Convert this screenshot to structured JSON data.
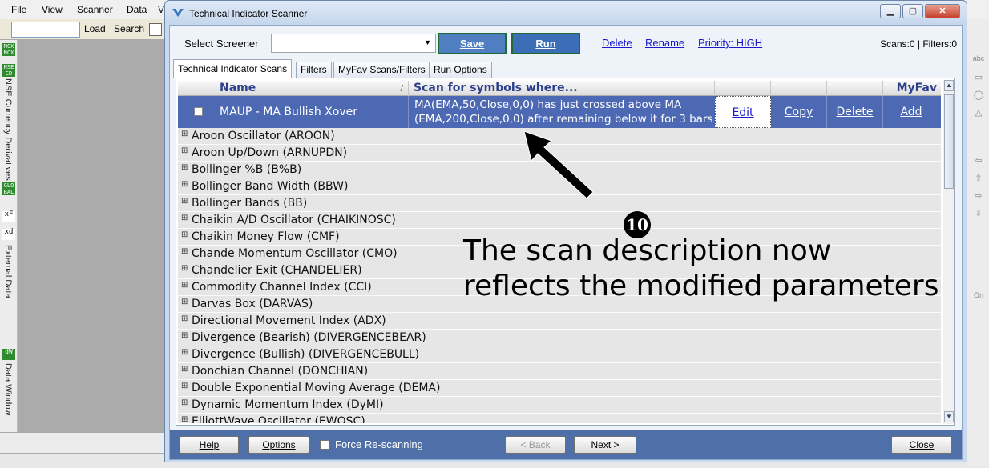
{
  "app_menu": {
    "items": [
      {
        "label": "File",
        "accel": "F",
        "rest": "ile"
      },
      {
        "label": "View",
        "accel": "V",
        "rest": "iew"
      },
      {
        "label": "Scanner",
        "accel": "S",
        "rest": "canner"
      },
      {
        "label": "Data",
        "accel": "D",
        "rest": "ata"
      },
      {
        "label": "V",
        "accel": "V",
        "rest": ""
      }
    ]
  },
  "bg_toolbar": {
    "load_label": "Load",
    "search_label": "Search"
  },
  "left_sidebar": {
    "badges": [
      "MCX NCX",
      "NSE CD",
      "GLO BAL"
    ],
    "labels": [
      "NSE Currency Derivatives",
      "External Data",
      "Data Window"
    ],
    "icon_f": "xF",
    "icon_d": "xd",
    "icon_dw": "dW"
  },
  "dialog": {
    "title": "Technical Indicator Scanner",
    "select_screener_label": "Select Screener",
    "screener_value": "",
    "save_label": "Save",
    "run_label": "Run",
    "delete_link": "Delete",
    "rename_link": "Rename",
    "priority_link": "Priority: HIGH",
    "scans_count": "Scans:0 | Filters:0",
    "tabs": [
      {
        "label": "Technical Indicator Scans",
        "active": true
      },
      {
        "label": "Filters",
        "active": false
      },
      {
        "label": "MyFav Scans/Filters",
        "active": false
      },
      {
        "label": "Run Options",
        "active": false
      }
    ],
    "grid": {
      "headers": {
        "name": "Name",
        "sort_marker": "/",
        "scan": "Scan for symbols where...",
        "myfav": "MyFav"
      },
      "selected_row": {
        "name": "MAUP - MA Bullish Xover",
        "description_line1": "MA(EMA,50,Close,0,0) has just crossed above MA",
        "description_line2": "(EMA,200,Close,0,0) after remaining below it for 3 bars",
        "actions": {
          "edit": "Edit",
          "copy": "Copy",
          "delete": "Delete",
          "add": "Add"
        }
      },
      "rows": [
        "Aroon Oscillator (AROON)",
        "Aroon Up/Down (ARNUPDN)",
        "Bollinger %B (B%B)",
        "Bollinger Band Width (BBW)",
        "Bollinger Bands (BB)",
        "Chaikin A/D Oscillator (CHAIKINOSC)",
        "Chaikin Money Flow (CMF)",
        "Chande Momentum Oscillator (CMO)",
        "Chandelier Exit (CHANDELIER)",
        "Commodity Channel Index (CCI)",
        "Darvas Box (DARVAS)",
        "Directional Movement Index (ADX)",
        "Divergence (Bearish) (DIVERGENCEBEAR)",
        "Divergence (Bullish) (DIVERGENCEBULL)",
        "Donchian Channel (DONCHIAN)",
        "Double Exponential Moving Average (DEMA)",
        "Dynamic Momentum Index (DyMI)",
        "ElliottWave Oscillator (EWOSC)"
      ]
    },
    "annotation": {
      "number": "10",
      "line1": "The scan description now",
      "line2": "reflects the modified parameters"
    },
    "footer": {
      "help_label": "Help",
      "options_label": "Options",
      "force_rescan_label": "Force Re-scanning",
      "force_rescan_checked": false,
      "back_label": "< Back",
      "next_label": "Next >",
      "close_label": "Close"
    }
  },
  "colors": {
    "selected_row": "#4d69b4",
    "footer_bar": "#4f6fa8",
    "header_text": "#2b3f8a",
    "link": "#1a1acc"
  }
}
